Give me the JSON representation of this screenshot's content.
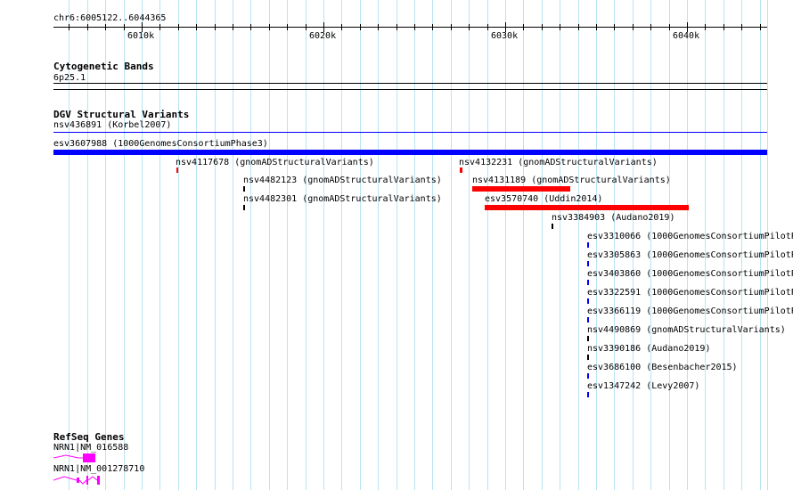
{
  "ruler": {
    "range_label": "chr6:6005122..6044365",
    "ticks": [
      "6010k",
      "6020k",
      "6030k",
      "6040k"
    ]
  },
  "cytobands": {
    "title": "Cytogenetic Bands",
    "band": "6p25.1"
  },
  "dgv": {
    "title": "DGV Structural Variants",
    "first_label": "nsv436891 (Korbel2007)",
    "features": [
      {
        "label": "esv3607988 (1000GenomesConsortiumPhase3)",
        "color": "#0000ff"
      },
      {
        "label": "nsv4117678 (gnomADStructuralVariants)",
        "color": "#ff0000"
      },
      {
        "label": "nsv4132231 (gnomADStructuralVariants)",
        "color": "#ff0000"
      },
      {
        "label": "nsv4482123 (gnomADStructuralVariants)",
        "color": "#000000"
      },
      {
        "label": "nsv4131189 (gnomADStructuralVariants)",
        "color": "#ff0000"
      },
      {
        "label": "nsv4482301 (gnomADStructuralVariants)",
        "color": "#000000"
      },
      {
        "label": "esv3570740 (Uddin2014)",
        "color": "#ff0000"
      },
      {
        "label": "nsv3384903 (Audano2019)",
        "color": "#000000"
      },
      {
        "label": "esv3310066 (1000GenomesConsortiumPilotP",
        "color": "#0000ff"
      },
      {
        "label": "esv3305863 (1000GenomesConsortiumPilotP",
        "color": "#0000ff"
      },
      {
        "label": "esv3403860 (1000GenomesConsortiumPilotP",
        "color": "#0000ff"
      },
      {
        "label": "esv3322591 (1000GenomesConsortiumPilotP",
        "color": "#0000ff"
      },
      {
        "label": "esv3366119 (1000GenomesConsortiumPilotP",
        "color": "#0000ff"
      },
      {
        "label": "nsv4490869 (gnomADStructuralVariants)",
        "color": "#000000"
      },
      {
        "label": "nsv3390186 (Audano2019)",
        "color": "#000000"
      },
      {
        "label": "esv3686100 (Besenbacher2015)",
        "color": "#0000ff"
      },
      {
        "label": "esv1347242 (Levy2007)",
        "color": "#0000ff"
      }
    ]
  },
  "refseq": {
    "title": "RefSeq Genes",
    "transcripts": [
      {
        "label": "NRN1|NM_016588",
        "color": "#ff00ff"
      },
      {
        "label": "NRN1|NM_001278710",
        "color": "#ff00ff"
      }
    ]
  }
}
